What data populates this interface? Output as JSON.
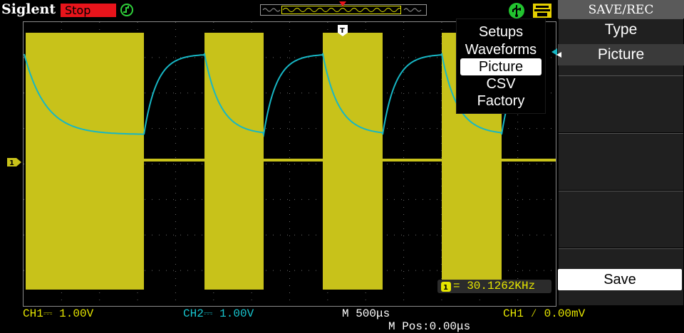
{
  "header": {
    "brand": "Siglent",
    "run_state": "Stop"
  },
  "popup": {
    "items": [
      "Setups",
      "Waveforms",
      "Picture",
      "CSV",
      "Factory"
    ],
    "selected_index": 2
  },
  "menu": {
    "title": "SAVE/REC",
    "type_label": "Type",
    "type_value": "Picture",
    "save_label": "Save"
  },
  "measurement": {
    "frequency": "30.1262KHz"
  },
  "status": {
    "ch1": "CH1⎓ 1.00V",
    "ch2": "CH2⎓ 1.00V",
    "timebase": "M 500μs",
    "position": "M Pos:0.00μs",
    "trigger": "CH1 ∕ 0.00mV"
  },
  "colors": {
    "ch1": "#c8c21a",
    "ch2": "#17b6c4",
    "stop": "#e8141b",
    "grid": "#9a9a9a"
  },
  "icons": {
    "trigger_status": "trigger-icon",
    "usb": "usb-icon",
    "printer": "printer-icon"
  }
}
